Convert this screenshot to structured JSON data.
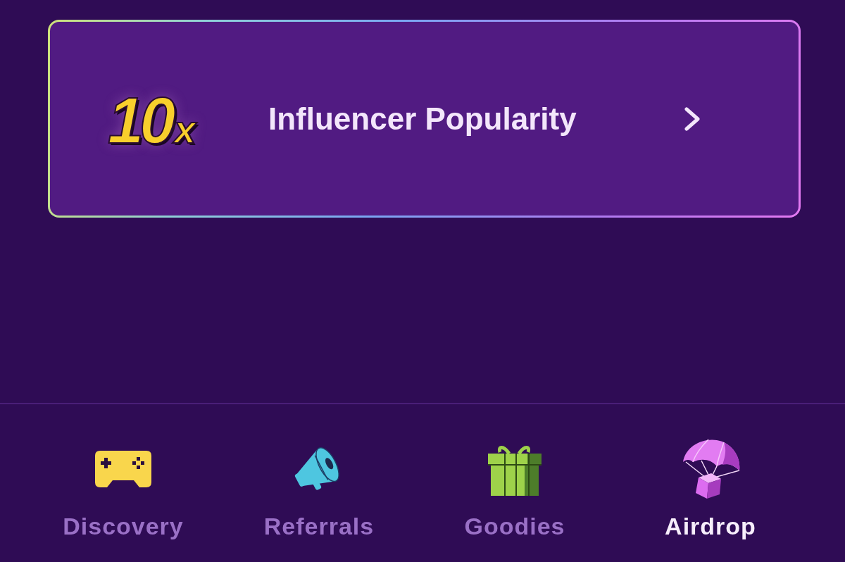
{
  "card": {
    "multiplier": "10$_{x}$",
    "title": "Influencer Popularity"
  },
  "tabs": [
    {
      "label": "Discovery",
      "selected": false
    },
    {
      "label": "Referrals",
      "selected": false
    },
    {
      "label": "Goodies",
      "selected": false
    },
    {
      "label": "Airdrop",
      "selected": true
    }
  ]
}
